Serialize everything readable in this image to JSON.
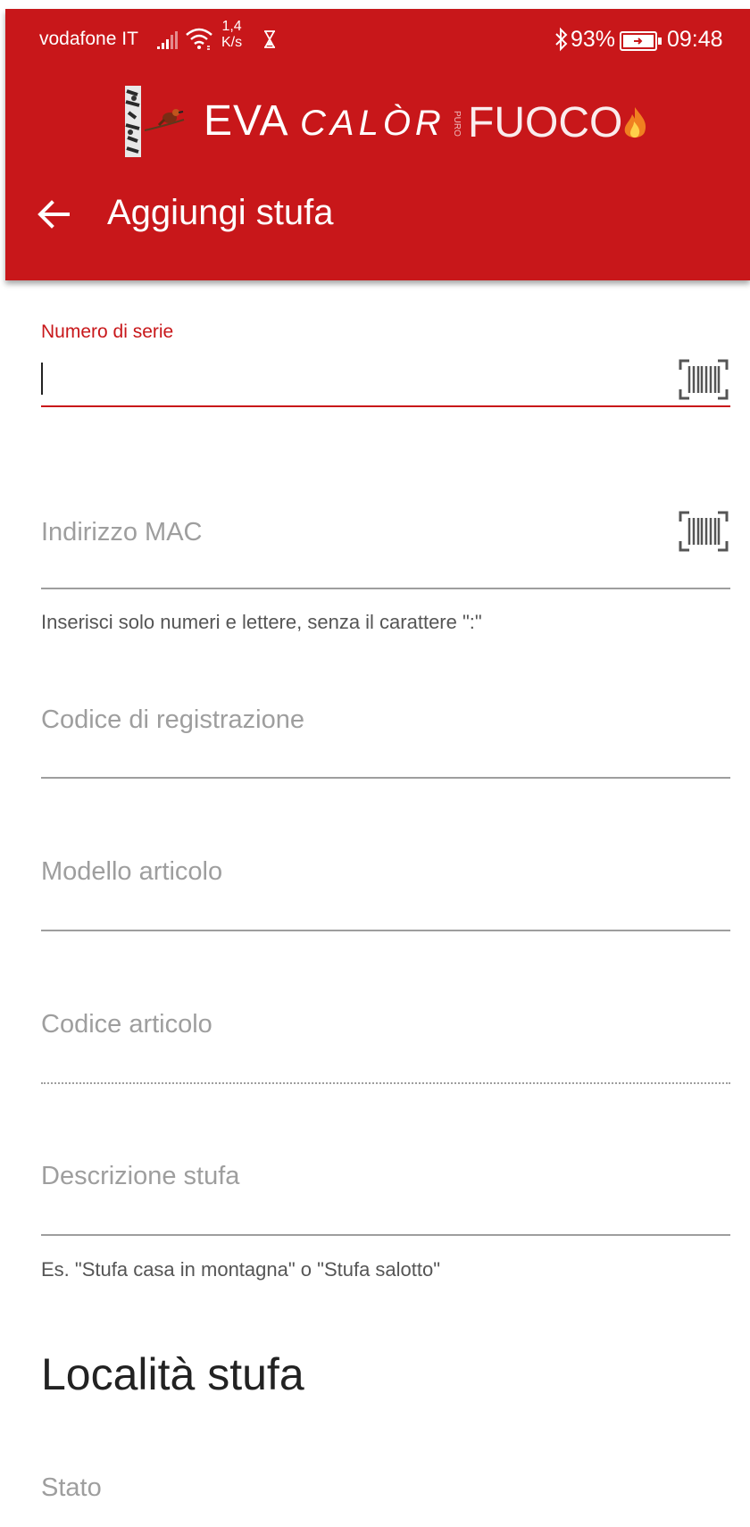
{
  "status_bar": {
    "carrier": "vodafone IT",
    "speed_value": "1,4",
    "speed_unit": "K/s",
    "battery_percent": "93%",
    "time": "09:48",
    "icons": [
      "signal-icon",
      "wifi-icon",
      "hourglass-icon",
      "bluetooth-icon",
      "battery-icon"
    ]
  },
  "logo": {
    "eva": "EVA",
    "calor": "CALÒR",
    "puro": "PURO",
    "fuoco": "FUOCO"
  },
  "app_bar": {
    "title": "Aggiungi stufa",
    "back_icon": "arrow-left-icon",
    "color": "#c8171a"
  },
  "form": {
    "serial_number": {
      "label": "Numero di serie",
      "value": "",
      "icon": "barcode-scan-icon"
    },
    "mac_address": {
      "placeholder": "Indirizzo MAC",
      "helper": "Inserisci solo numeri e lettere, senza il carattere \":\"",
      "icon": "barcode-scan-icon"
    },
    "registration_code": {
      "placeholder": "Codice di registrazione"
    },
    "item_model": {
      "placeholder": "Modello articolo"
    },
    "item_code": {
      "placeholder": "Codice articolo"
    },
    "stove_description": {
      "placeholder": "Descrizione stufa",
      "helper": "Es. \"Stufa casa in montagna\" o \"Stufa salotto\""
    }
  },
  "location_section": {
    "title": "Località stufa",
    "state": {
      "placeholder": "Stato"
    }
  }
}
